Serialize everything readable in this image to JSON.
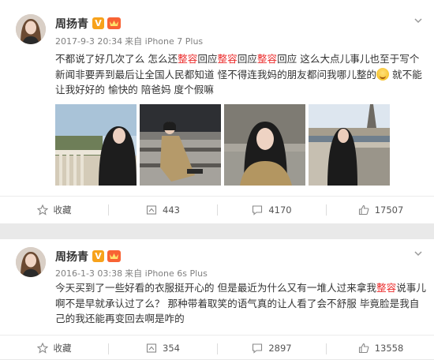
{
  "posts": [
    {
      "author": "周扬青",
      "verified_badge": "V",
      "time": "2017-9-3 20:34",
      "source": "来自 iPhone 7 Plus",
      "text": [
        {
          "t": "不都说了好几次了么 怎么还",
          "hl": false
        },
        {
          "t": "整容",
          "hl": true
        },
        {
          "t": "回应",
          "hl": false
        },
        {
          "t": "整容",
          "hl": true
        },
        {
          "t": "回应",
          "hl": false
        },
        {
          "t": "整容",
          "hl": true
        },
        {
          "t": "回应 这么大点儿事儿也至于写个新闻非要弄到最后让全国人民都知道 怪不得连我妈的朋友都问我哪儿整的",
          "hl": false
        },
        {
          "t": "[emoji]",
          "hl": false
        },
        {
          "t": " 就不能让我好好的 愉快的 陪爸妈 度个假嘛",
          "hl": false
        }
      ],
      "photos": [
        "photo-1",
        "photo-2",
        "photo-3",
        "photo-4"
      ],
      "actions": {
        "favorite": "收藏",
        "repost": "443",
        "comment": "4170",
        "like": "17507"
      }
    },
    {
      "author": "周扬青",
      "verified_badge": "V",
      "time": "2016-1-3 03:38",
      "source": "来自 iPhone 6s Plus",
      "text": [
        {
          "t": "今天买到了一些好看的衣服挺开心的 但是最近为什么又有一堆人过来拿我",
          "hl": false
        },
        {
          "t": "整容",
          "hl": true
        },
        {
          "t": "说事儿 啊不是早就承认过了么？ 那种带着取笑的语气真的让人看了会不舒服 毕竟脸是我自己的我还能再变回去啊是咋的",
          "hl": false
        }
      ],
      "actions": {
        "favorite": "收藏",
        "repost": "354",
        "comment": "2897",
        "like": "13558"
      }
    }
  ],
  "icons": [
    "avatar",
    "verified-v-icon",
    "member-level-icon",
    "chevron-down-icon",
    "star-icon",
    "repost-icon",
    "comment-icon",
    "like-icon",
    "laugh-emoji-icon"
  ],
  "colors": {
    "highlight": "#eb2d2d",
    "meta": "#808080",
    "badge": "#f7a21b",
    "text": "#333333"
  }
}
